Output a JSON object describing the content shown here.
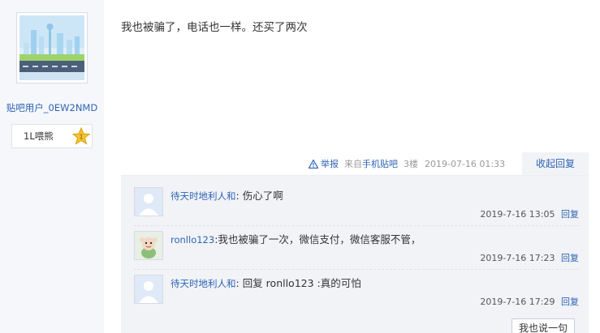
{
  "author": {
    "username": "贴吧用户_0EW2NMD",
    "level_name": "1L喂熊",
    "level_number": "1",
    "avatar_icon": "city-skyline-avatar-icon"
  },
  "post": {
    "content": "我也被骗了，电话也一样。还买了两次",
    "report_label": "举报",
    "source_prefix": "来自",
    "source_name": "手机贴吧",
    "floor": "3楼",
    "time": "2019-07-16 01:33",
    "fold_reply_label": "收起回复"
  },
  "replies": [
    {
      "user": "待天时地利人和",
      "separator": ":",
      "text": "伤心了啊",
      "time": "2019-7-16 13:05",
      "reply_label": "回复",
      "avatar_icon": "default-avatar-icon"
    },
    {
      "user": "ronllo123",
      "separator": ":",
      "text": "我也被骗了一次，微信支付，微信客服不管，",
      "time": "2019-7-16 17:23",
      "reply_label": "回复",
      "avatar_icon": "cartoon-avatar-icon"
    },
    {
      "user": "待天时地利人和",
      "separator": ":",
      "text": "回复 ronllo123 :真的可怕",
      "time": "2019-7-16 17:29",
      "reply_label": "回复",
      "avatar_icon": "default-avatar-icon"
    }
  ],
  "say_button_label": "我也说一句",
  "colors": {
    "link": "#2d64b3",
    "sidebar_bg": "#f6f7fb",
    "reply_bg": "#f2f3f7"
  }
}
